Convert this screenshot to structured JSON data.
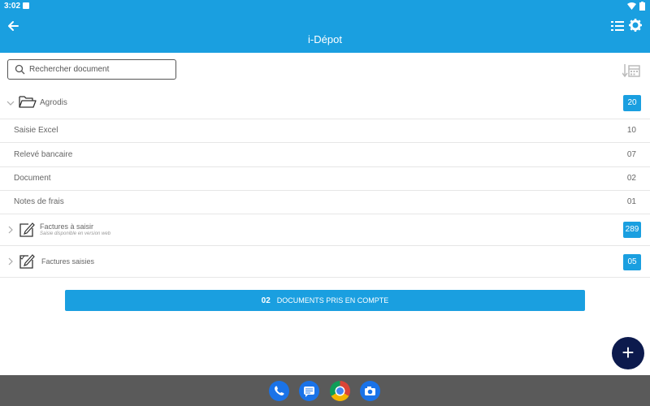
{
  "status": {
    "time": "3:02"
  },
  "header": {
    "title": "i-Dépot"
  },
  "search": {
    "placeholder": "Rechercher document"
  },
  "folder": {
    "label": "Agrodis",
    "count": "20"
  },
  "subitems": [
    {
      "label": "Saisie Excel",
      "count": "10"
    },
    {
      "label": "Relevé bancaire",
      "count": "07"
    },
    {
      "label": "Document",
      "count": "02"
    },
    {
      "label": "Notes de frais",
      "count": "01"
    }
  ],
  "factures_a_saisir": {
    "label": "Factures à saisir",
    "sublabel": "Saisie disponible en version web",
    "count": "289"
  },
  "factures_saisies": {
    "label": "Factures saisies",
    "count": "05"
  },
  "cta": {
    "count": "02",
    "label": "DOCUMENTS PRIS EN COMPTE"
  },
  "fab": {
    "label": "+"
  },
  "colors": {
    "accent": "#1a9fe0",
    "fab": "#0c1a4d",
    "navbar": "#5a5a5a"
  }
}
